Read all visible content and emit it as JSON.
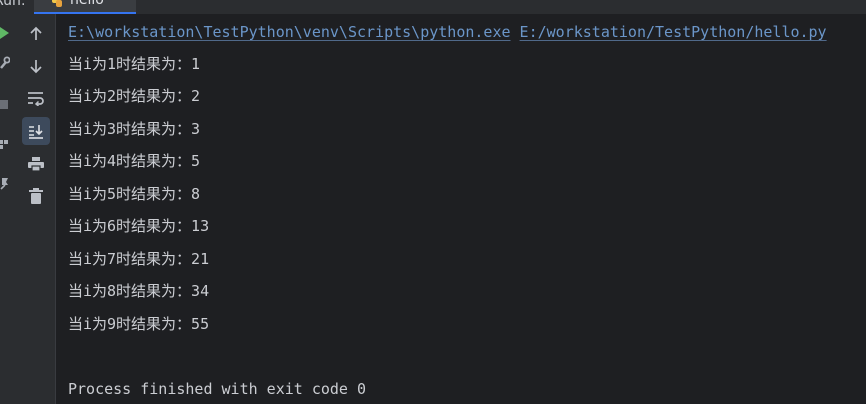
{
  "window": {
    "run_label": "Run:",
    "tab_label": "hello"
  },
  "toolbar": {
    "buttons": [
      {
        "icon": "arrow-up-icon",
        "name": "scroll-up-button"
      },
      {
        "icon": "arrow-down-icon",
        "name": "scroll-down-button"
      },
      {
        "icon": "soft-wrap-icon",
        "name": "soft-wrap-button"
      },
      {
        "icon": "scroll-to-end-icon",
        "name": "scroll-to-end-button",
        "active": true
      },
      {
        "icon": "print-icon",
        "name": "print-button"
      },
      {
        "icon": "trash-icon",
        "name": "clear-all-button"
      }
    ]
  },
  "console": {
    "command": {
      "interpreter": "E:\\workstation\\TestPython\\venv\\Scripts\\python.exe",
      "script": "E:/workstation/TestPython/hello.py"
    },
    "output_lines": [
      "当i为1时结果为：1",
      "当i为2时结果为：2",
      "当i为3时结果为：3",
      "当i为4时结果为：5",
      "当i为5时结果为：8",
      "当i为6时结果为：13",
      "当i为7时结果为：21",
      "当i为8时结果为：34",
      "当i为9时结果为：55"
    ],
    "exit_message": "Process finished with exit code 0"
  },
  "colors": {
    "console_bg": "#1e1f22",
    "toolbar_bg": "#2b2d30",
    "text": "#cbcdd2",
    "link": "#6b96c9",
    "active_button": "#3d4a5c",
    "run_green": "#5fb865"
  }
}
